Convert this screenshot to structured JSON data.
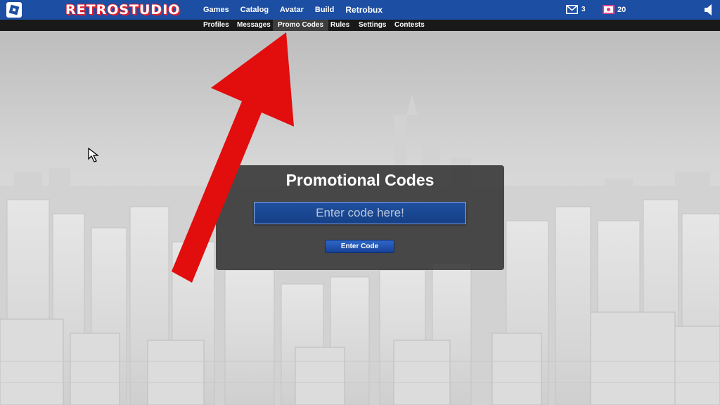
{
  "header": {
    "brand": "RETROSTUDIO",
    "nav": [
      "Games",
      "Catalog",
      "Avatar",
      "Build",
      "Retrobux"
    ],
    "messages_count": "3",
    "currency_count": "20",
    "icons": {
      "logo": "roblox-logo-icon",
      "messages": "envelope-icon",
      "currency": "robux-icon",
      "sound": "speaker-icon"
    }
  },
  "subnav": {
    "items": [
      "Profiles",
      "Messages",
      "Promo Codes",
      "Rules",
      "Settings",
      "Contests"
    ],
    "active": "Promo Codes"
  },
  "promo": {
    "title": "Promotional Codes",
    "input_placeholder": "Enter code here!",
    "button_label": "Enter Code"
  },
  "colors": {
    "header": "#1c4ea3",
    "subnav": "#191919",
    "panel": "#282828",
    "button": "#2f67c8",
    "arrow": "#e20d0d",
    "brand_outline": "#e02030"
  }
}
